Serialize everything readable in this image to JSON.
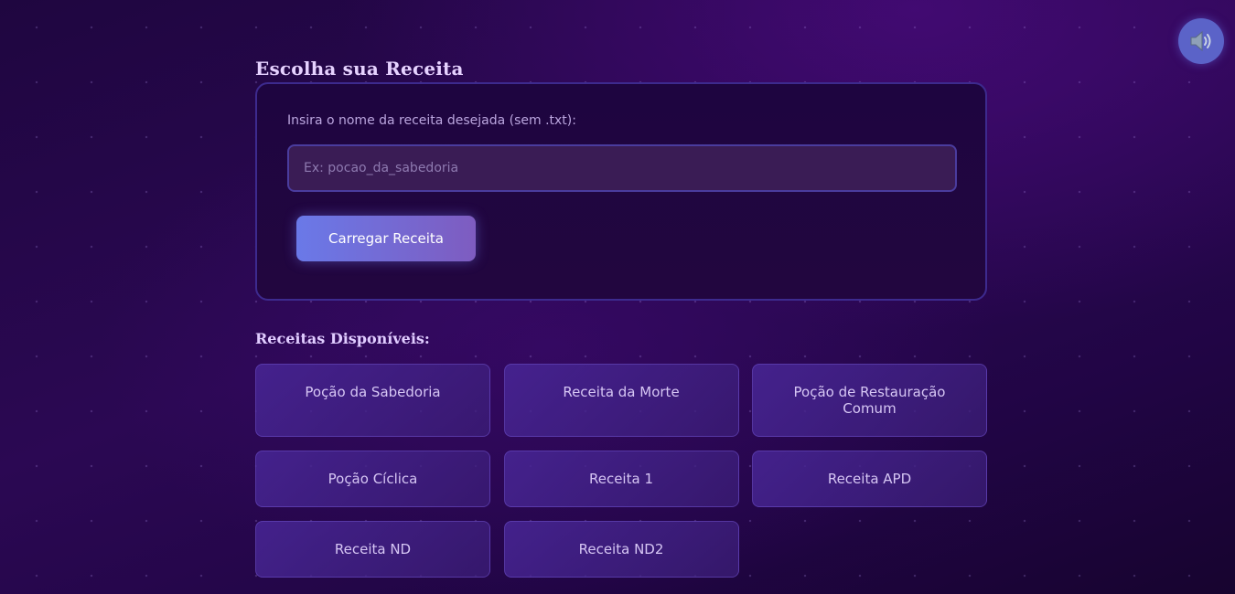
{
  "header": {
    "title": "Escolha sua Receita",
    "sound_icon": "speaker-icon"
  },
  "form": {
    "label": "Insira o nome da receita desejada (sem .txt):",
    "input_value": "",
    "input_placeholder": "Ex: pocao_da_sabedoria",
    "load_button_label": "Carregar Receita"
  },
  "recipes": {
    "title": "Receitas Disponíveis:",
    "items": [
      {
        "label": "Poção da Sabedoria"
      },
      {
        "label": "Receita da Morte"
      },
      {
        "label": "Poção de Restauração Comum"
      },
      {
        "label": "Poção Cíclica"
      },
      {
        "label": "Receita 1"
      },
      {
        "label": "Receita APD"
      },
      {
        "label": "Receita ND"
      },
      {
        "label": "Receita ND2"
      }
    ]
  },
  "colors": {
    "background": "#2b0853",
    "accent": "#6a79e8",
    "card_border": "#3d2a8e",
    "sound_button": "#5b63c8"
  }
}
